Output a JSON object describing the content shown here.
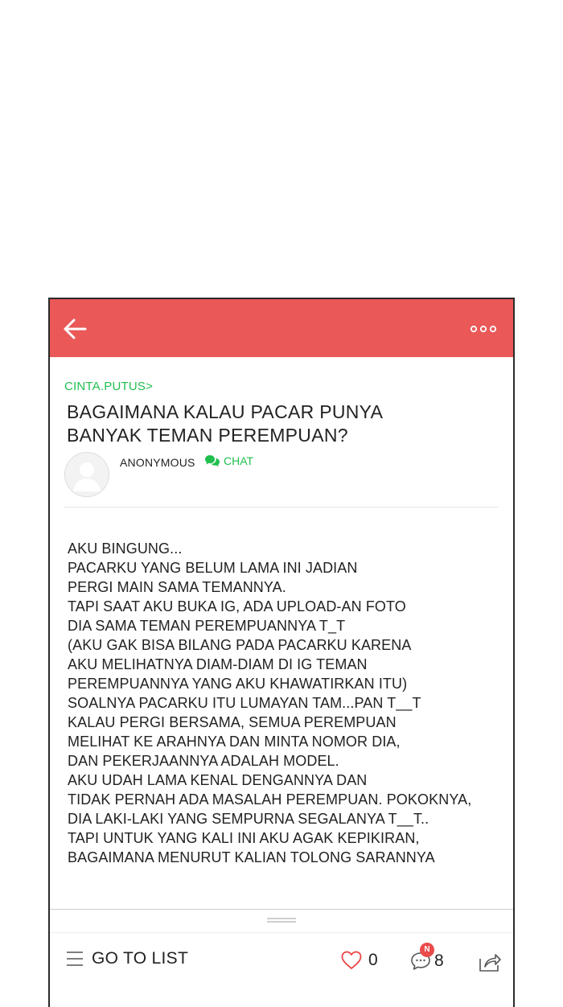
{
  "post": {
    "category": "CINTA.PUTUS>",
    "title_lines": [
      "BAGAIMANA KALAU PACAR PUNYA",
      "BANYAK TEMAN PEREMPUAN?"
    ],
    "author": "ANONYMOUS",
    "chat_label": "CHAT",
    "body_lines": [
      "AKU BINGUNG...",
      "PACARKU YANG BELUM LAMA INI JADIAN",
      "PERGI MAIN SAMA TEMANNYA.",
      "TAPI SAAT AKU BUKA IG, ADA UPLOAD-AN FOTO",
      "DIA SAMA TEMAN PEREMPUANNYA T_T",
      "(AKU GAK BISA BILANG PADA PACARKU KARENA",
      "AKU MELIHATNYA DIAM-DIAM DI IG TEMAN",
      "PEREMPUANNYA YANG AKU KHAWATIRKAN ITU)",
      "SOALNYA PACARKU ITU LUMAYAN TAM...PAN T__T",
      "KALAU PERGI BERSAMA, SEMUA PEREMPUAN",
      "MELIHAT KE ARAHNYA DAN MINTA NOMOR DIA,",
      "DAN PEKERJAANNYA ADALAH MODEL.",
      "AKU UDAH LAMA KENAL DENGANNYA DAN",
      "TIDAK PERNAH ADA MASALAH PEREMPUAN. POKOKNYA,",
      "DIA LAKI-LAKI YANG SEMPURNA SEGALANYA T__T..",
      "TAPI UNTUK YANG KALI INI AKU AGAK KEPIKIRAN,",
      "BAGAIMANA MENURUT KALIAN TOLONG SARANNYA"
    ]
  },
  "bottom_bar": {
    "list_label": "GO TO LIST",
    "like_count": "0",
    "comment_count": "8",
    "new_badge": "N"
  },
  "icons": {
    "back": "arrow-left-icon",
    "more": "more-dots-icon",
    "chat": "chat-bubbles-icon",
    "list": "hamburger-list-icon",
    "like": "heart-outline-icon",
    "comment": "comment-bubble-icon",
    "share": "share-icon",
    "avatar": "default-avatar-icon"
  },
  "colors": {
    "accent_red": "#ea5858",
    "accent_green": "#1fbf4e",
    "heart_red": "#e84545",
    "badge_red": "#ea4b4b"
  }
}
